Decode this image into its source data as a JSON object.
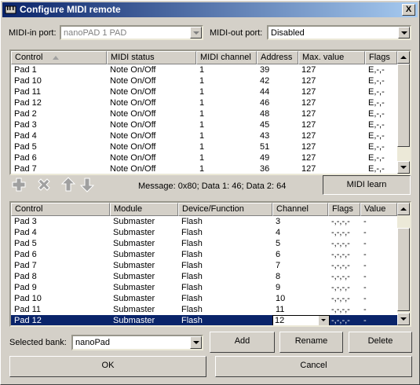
{
  "window": {
    "title": "Configure MIDI remote",
    "close_label": "X"
  },
  "ports": {
    "in_label": "MIDI-in port:",
    "in_value": "nanoPAD 1 PAD",
    "out_label": "MIDI-out port:",
    "out_value": "Disabled"
  },
  "top_table": {
    "columns": [
      "Control",
      "MIDI status",
      "MIDI channel",
      "Address",
      "Max. value",
      "Flags"
    ],
    "rows": [
      [
        "Pad 1",
        "Note On/Off",
        "1",
        "39",
        "127",
        "E,-,-"
      ],
      [
        "Pad 10",
        "Note On/Off",
        "1",
        "42",
        "127",
        "E,-,-"
      ],
      [
        "Pad 11",
        "Note On/Off",
        "1",
        "44",
        "127",
        "E,-,-"
      ],
      [
        "Pad 12",
        "Note On/Off",
        "1",
        "46",
        "127",
        "E,-,-"
      ],
      [
        "Pad 2",
        "Note On/Off",
        "1",
        "48",
        "127",
        "E,-,-"
      ],
      [
        "Pad 3",
        "Note On/Off",
        "1",
        "45",
        "127",
        "E,-,-"
      ],
      [
        "Pad 4",
        "Note On/Off",
        "1",
        "43",
        "127",
        "E,-,-"
      ],
      [
        "Pad 5",
        "Note On/Off",
        "1",
        "51",
        "127",
        "E,-,-"
      ],
      [
        "Pad 6",
        "Note On/Off",
        "1",
        "49",
        "127",
        "E,-,-"
      ],
      [
        "Pad 7",
        "Note On/Off",
        "1",
        "36",
        "127",
        "E,-,-"
      ]
    ]
  },
  "toolbar": {
    "icons": [
      "add-icon",
      "delete-icon",
      "arrow-up-icon",
      "arrow-down-icon"
    ],
    "message": "Message: 0x80; Data 1: 46; Data 2: 64",
    "learn_label": "MIDI learn"
  },
  "bottom_table": {
    "columns": [
      "Control",
      "Module",
      "Device/Function",
      "Channel",
      "Flags",
      "Value"
    ],
    "rows": [
      [
        "Pad 3",
        "Submaster",
        "Flash",
        "3",
        "-,-,-,-",
        "-"
      ],
      [
        "Pad 4",
        "Submaster",
        "Flash",
        "4",
        "-,-,-,-",
        "-"
      ],
      [
        "Pad 5",
        "Submaster",
        "Flash",
        "5",
        "-,-,-,-",
        "-"
      ],
      [
        "Pad 6",
        "Submaster",
        "Flash",
        "6",
        "-,-,-,-",
        "-"
      ],
      [
        "Pad 7",
        "Submaster",
        "Flash",
        "7",
        "-,-,-,-",
        "-"
      ],
      [
        "Pad 8",
        "Submaster",
        "Flash",
        "8",
        "-,-,-,-",
        "-"
      ],
      [
        "Pad 9",
        "Submaster",
        "Flash",
        "9",
        "-,-,-,-",
        "-"
      ],
      [
        "Pad 10",
        "Submaster",
        "Flash",
        "10",
        "-,-,-,-",
        "-"
      ],
      [
        "Pad 11",
        "Submaster",
        "Flash",
        "11",
        "-,-,-,-",
        "-"
      ],
      [
        "Pad 12",
        "Submaster",
        "Flash",
        "12",
        "-,-,-,-",
        "-"
      ]
    ],
    "selected_index": 9
  },
  "bank": {
    "label": "Selected bank:",
    "value": "nanoPad",
    "add_label": "Add",
    "rename_label": "Rename",
    "delete_label": "Delete"
  },
  "dialog": {
    "ok_label": "OK",
    "cancel_label": "Cancel"
  },
  "colors": {
    "titlebar_start": "#0a246a",
    "titlebar_end": "#a6caf0",
    "selection": "#0a246a",
    "face": "#d4d0c8"
  }
}
